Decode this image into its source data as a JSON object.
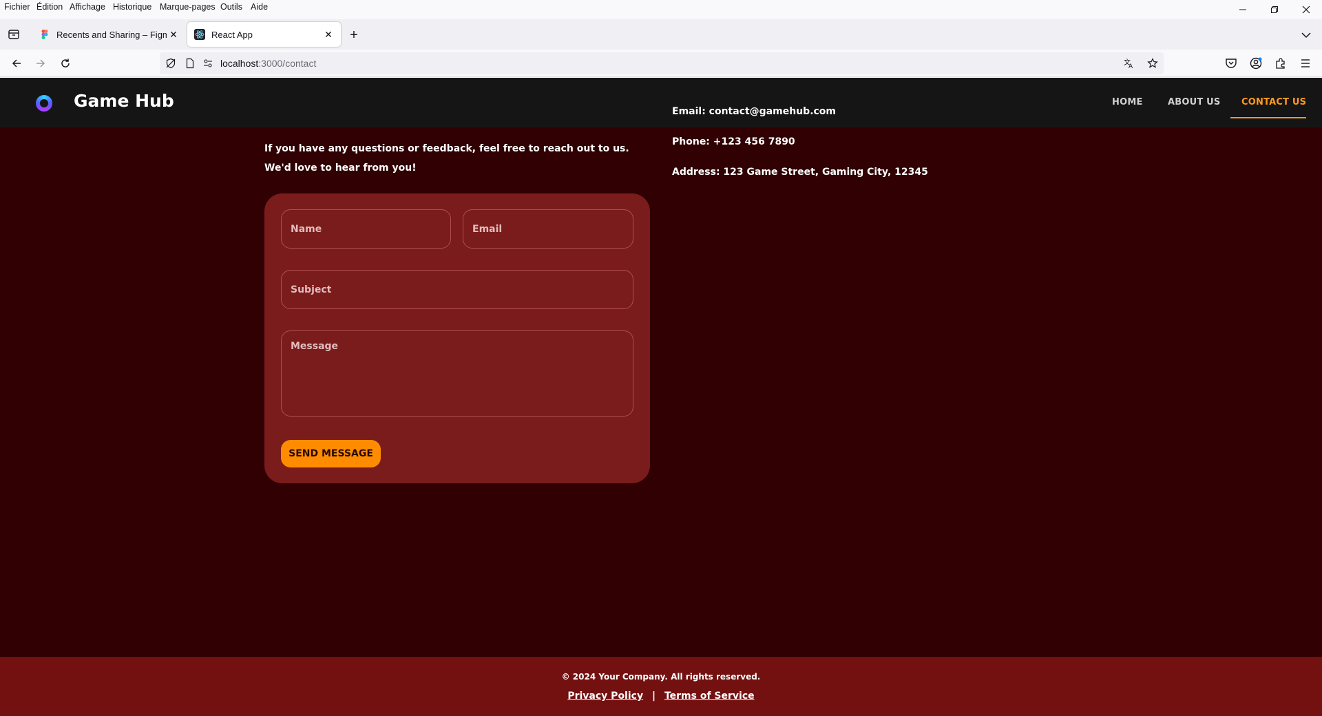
{
  "browser": {
    "menu": [
      "Fichier",
      "Édition",
      "Affichage",
      "Historique",
      "Marque-pages",
      "Outils",
      "Aide"
    ],
    "tabs": [
      {
        "title": "Recents and Sharing – Figma",
        "active": false
      },
      {
        "title": "React App",
        "active": true
      }
    ],
    "url": {
      "host": "localhost",
      "path": ":3000/contact"
    }
  },
  "site": {
    "title": "Game Hub",
    "nav": [
      {
        "label": "HOME",
        "active": false
      },
      {
        "label": "ABOUT US",
        "active": false
      },
      {
        "label": "CONTACT US",
        "active": true
      }
    ]
  },
  "contact": {
    "intro": "If you have any questions or feedback, feel free to reach out to us. We'd love to hear from you!",
    "form": {
      "name_placeholder": "Name",
      "email_placeholder": "Email",
      "subject_placeholder": "Subject",
      "message_placeholder": "Message",
      "submit_label": "SEND MESSAGE"
    },
    "info": {
      "email": "Email: contact@gamehub.com",
      "phone": "Phone: +123 456 7890",
      "address": "Address: 123 Game Street, Gaming City, 12345"
    }
  },
  "footer": {
    "copyright": "© 2024 Your Company. All rights reserved.",
    "privacy": "Privacy Policy",
    "separator": "|",
    "terms": "Terms of Service"
  },
  "colors": {
    "accent": "#ff8c00",
    "page_bg": "#300002",
    "card_bg": "#7b1c1c",
    "footer_bg": "#731010",
    "header_bg": "#151515"
  }
}
